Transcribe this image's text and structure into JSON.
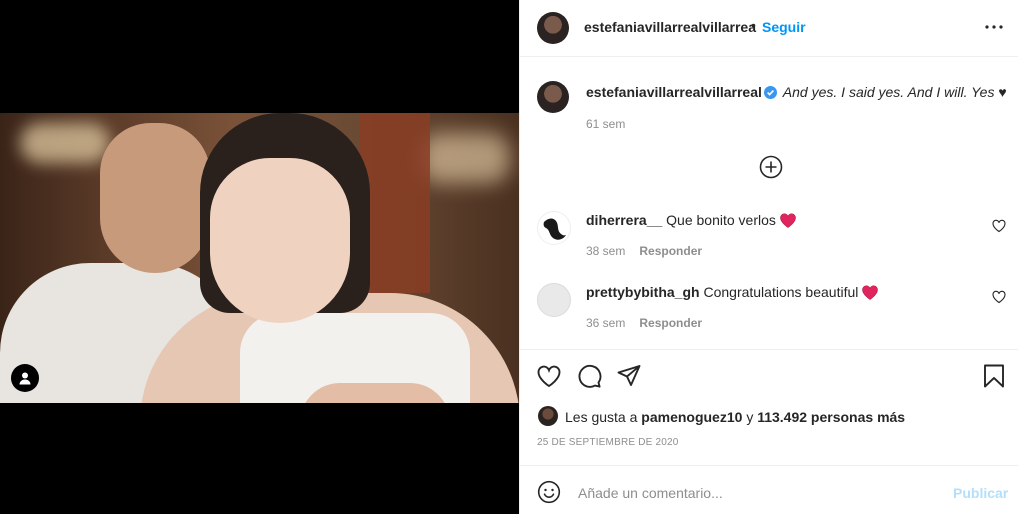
{
  "post": {
    "username": "estefaniavillarrealvillarrea",
    "follow_label": "Seguir",
    "separator": "•"
  },
  "caption": {
    "username": "estefaniavillarrealvillarreal",
    "text": "And yes. I said yes. And I will. Yes ♥",
    "time": "61 sem"
  },
  "comments": [
    {
      "username": "diherrera__",
      "text": "Que bonito verlos",
      "time": "38 sem",
      "reply_label": "Responder"
    },
    {
      "username": "prettybybitha_gh",
      "text": "Congratulations beautiful",
      "time": "36 sem",
      "reply_label": "Responder"
    }
  ],
  "likes": {
    "prefix": "Les gusta a",
    "user": "pamenoguez10",
    "connector": "y",
    "count_text": "113.492 personas más"
  },
  "date": "25 DE SEPTIEMBRE DE 2020",
  "comment_box": {
    "placeholder": "Añade un comentario...",
    "publish_label": "Publicar"
  },
  "colors": {
    "accent": "#0095f6",
    "publish_disabled": "#b2dffc",
    "heart": "#ed4956",
    "verified": "#3897f0",
    "muted": "#8e8e8e"
  },
  "icons": [
    "user-tag-icon",
    "more-icon",
    "verified-icon",
    "add-circle-icon",
    "heart-icon",
    "comment-icon",
    "share-icon",
    "bookmark-icon",
    "emoji-icon"
  ]
}
